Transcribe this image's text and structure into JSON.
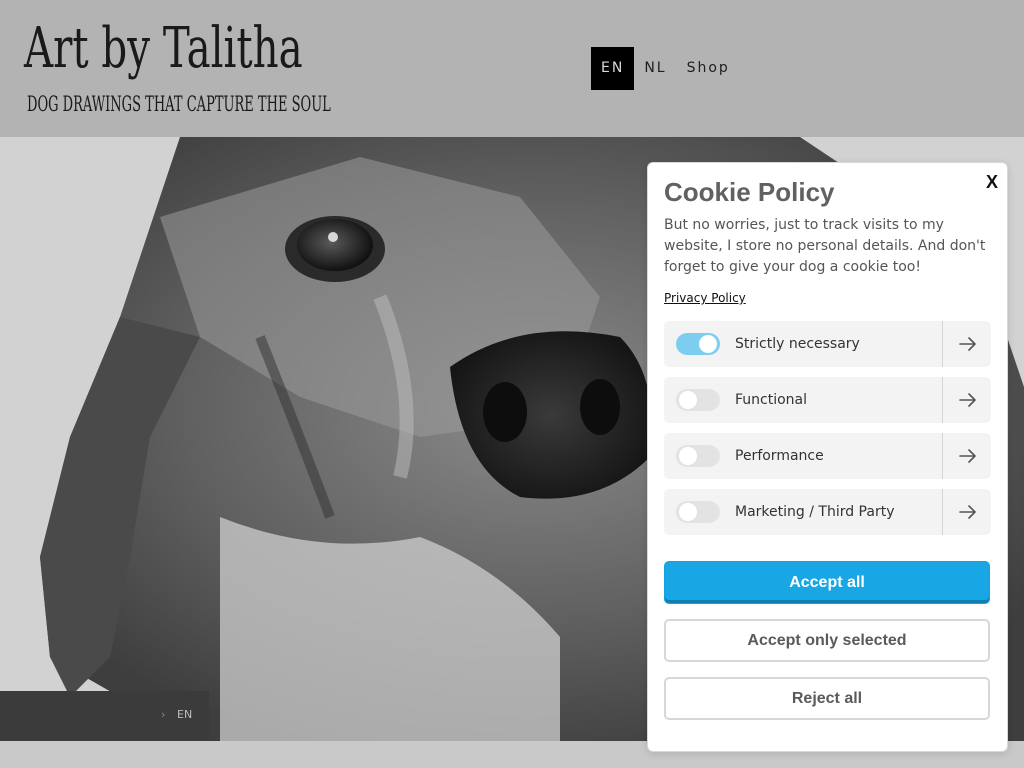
{
  "header": {
    "logo_title": "Art by Talitha",
    "logo_subtitle": "DOG DRAWINGS THAT CAPTURE THE SOUL",
    "nav": [
      {
        "label": "EN",
        "active": true
      },
      {
        "label": "NL",
        "active": false
      },
      {
        "label": "Shop",
        "active": false
      }
    ]
  },
  "language_bar": {
    "chevron": "›",
    "label": "EN"
  },
  "cookie_dialog": {
    "title": "Cookie Policy",
    "close_label": "X",
    "description": "But no worries, just to track visits to my website, I store no personal details. And don't forget to give your dog a cookie too!",
    "privacy_link": "Privacy Policy",
    "categories": [
      {
        "label": "Strictly necessary",
        "enabled": true
      },
      {
        "label": "Functional",
        "enabled": false
      },
      {
        "label": "Performance",
        "enabled": false
      },
      {
        "label": "Marketing / Third Party",
        "enabled": false
      }
    ],
    "buttons": {
      "accept_all": "Accept all",
      "accept_selected": "Accept only selected",
      "reject_all": "Reject all"
    },
    "colors": {
      "accent": "#19a6e4",
      "toggle_on": "#7ccdf0"
    }
  }
}
